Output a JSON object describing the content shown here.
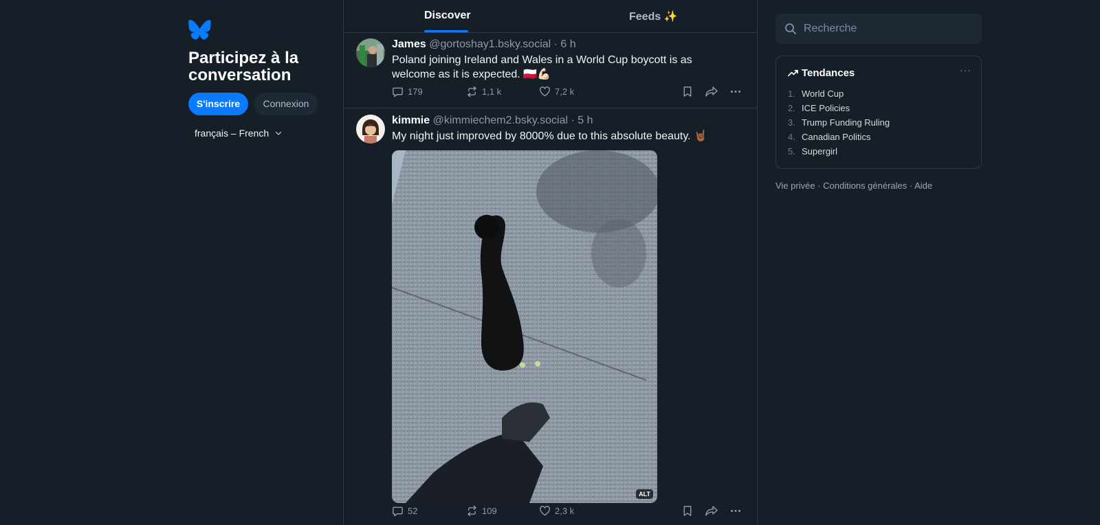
{
  "brand": {
    "logo_icon": "butterfly-logo-icon",
    "color": "#0a7aff"
  },
  "left": {
    "headline": "Participez à la conversation",
    "signup_label": "S'inscrire",
    "login_label": "Connexion",
    "language_label": "français – French"
  },
  "tabs": [
    {
      "label": "Discover",
      "active": true
    },
    {
      "label": "Feeds ✨",
      "active": false
    }
  ],
  "posts": [
    {
      "author": "James",
      "handle": "@gortoshay1.bsky.social",
      "time": "· 6 h",
      "text": "Poland joining Ireland and Wales in a World Cup boycott is as welcome as it is expected. 🇵🇱💪🏻",
      "replies": "179",
      "reposts": "1,1 k",
      "likes": "7,2 k"
    },
    {
      "author": "kimmie",
      "handle": "@kimmiechem2.bsky.social",
      "time": "· 5 h",
      "text": "My night just improved by 8000% due to this absolute beauty. 🤘🏾",
      "alt_badge": "ALT",
      "replies": "52",
      "reposts": "109",
      "likes": "2,3 k"
    }
  ],
  "search": {
    "placeholder": "Recherche"
  },
  "trends": {
    "title": "Tendances",
    "items": [
      {
        "num": "1.",
        "label": "World Cup"
      },
      {
        "num": "2.",
        "label": "ICE Policies"
      },
      {
        "num": "3.",
        "label": "Trump Funding Ruling"
      },
      {
        "num": "4.",
        "label": "Canadian Politics"
      },
      {
        "num": "5.",
        "label": "Supergirl"
      }
    ]
  },
  "footer": {
    "privacy": "Vie privée",
    "sep1": " · ",
    "terms": "Conditions générales",
    "sep2": " · ",
    "help": "Aide"
  }
}
